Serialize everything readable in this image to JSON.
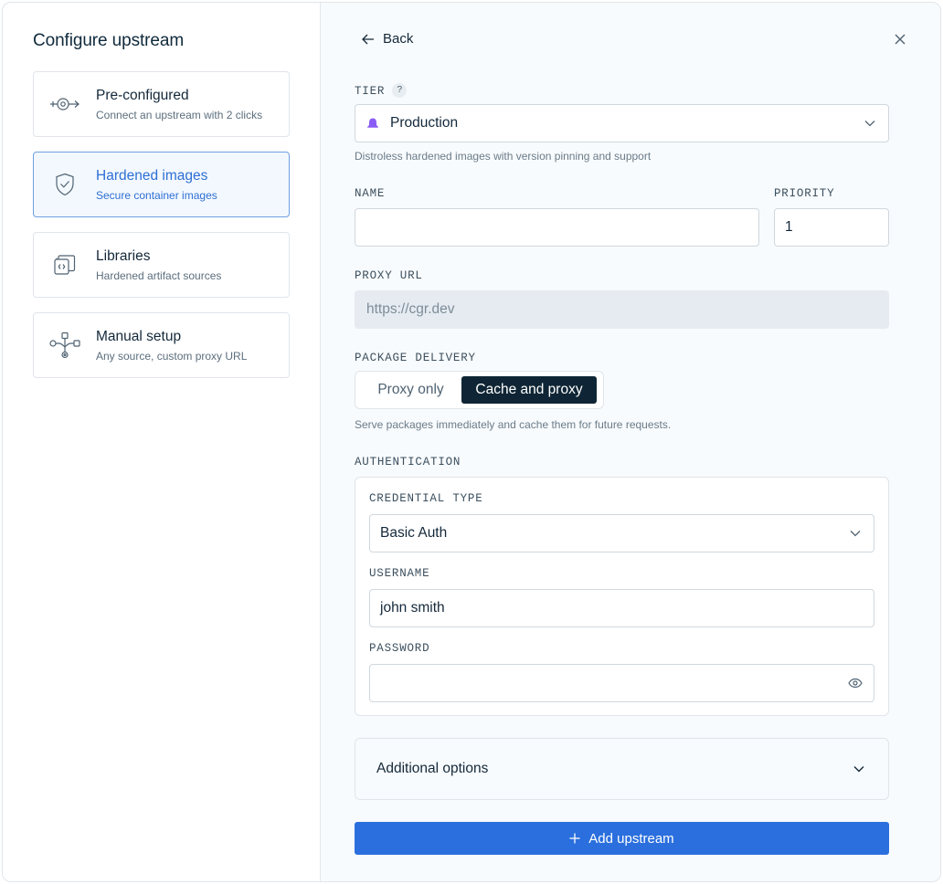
{
  "sidebar": {
    "title": "Configure upstream",
    "options": [
      {
        "title": "Pre-configured",
        "subtitle": "Connect an upstream with 2 clicks",
        "icon": "upstream-connect-icon"
      },
      {
        "title": "Hardened images",
        "subtitle": "Secure container images",
        "icon": "shield-check-icon",
        "selected": true
      },
      {
        "title": "Libraries",
        "subtitle": "Hardened artifact sources",
        "icon": "library-stack-icon"
      },
      {
        "title": "Manual setup",
        "subtitle": "Any source, custom proxy URL",
        "icon": "branch-flow-icon"
      }
    ]
  },
  "header": {
    "back_label": "Back"
  },
  "form": {
    "tier": {
      "label": "TIER",
      "help": "?",
      "value": "Production",
      "hint": "Distroless hardened images with version pinning and support"
    },
    "name": {
      "label": "NAME",
      "value": ""
    },
    "priority": {
      "label": "PRIORITY",
      "value": "1"
    },
    "proxy_url": {
      "label": "PROXY URL",
      "placeholder": "https://cgr.dev"
    },
    "delivery": {
      "label": "PACKAGE DELIVERY",
      "options": [
        "Proxy only",
        "Cache and proxy"
      ],
      "selected": "Cache and proxy",
      "hint": "Serve packages immediately and cache them for future requests."
    },
    "authentication": {
      "label": "AUTHENTICATION",
      "credential_type": {
        "label": "CREDENTIAL TYPE",
        "value": "Basic Auth"
      },
      "username": {
        "label": "USERNAME",
        "value": "john smith"
      },
      "password": {
        "label": "PASSWORD",
        "value": ""
      }
    },
    "additional_label": "Additional options",
    "submit_label": "Add upstream"
  },
  "colors": {
    "accent": "#2a6fdd",
    "selected_border": "#6fa0e2",
    "dark_toggle": "#0f2535",
    "tier_icon": "#8b5cf6"
  }
}
